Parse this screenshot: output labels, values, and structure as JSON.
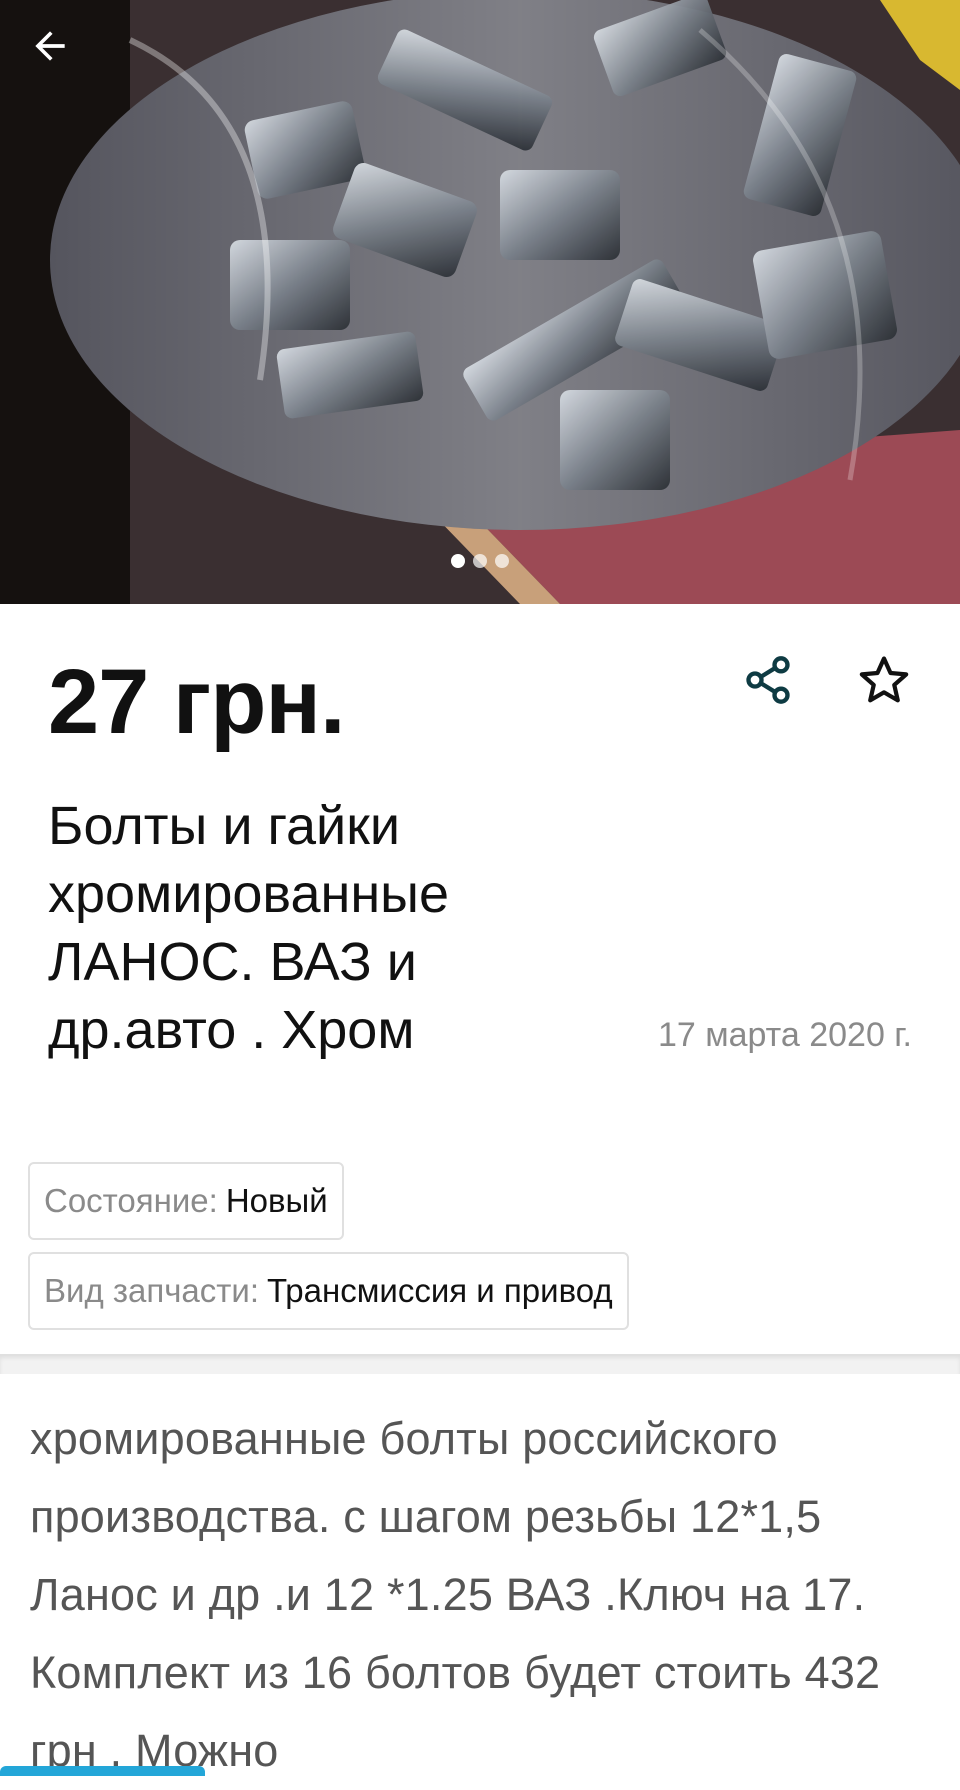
{
  "photo": {
    "alt": "bolts-photo",
    "slide_count": 3,
    "active_slide": 0
  },
  "listing": {
    "price": "27 грн.",
    "title": "Болты и гайки хромированные ЛАНОС. ВАЗ и др.авто . Хром",
    "date": "17 марта 2020 г.",
    "attributes": [
      {
        "key": "Состояние:",
        "value": "Новый"
      },
      {
        "key": "Вид запчасти:",
        "value": "Трансмиссия и привод"
      }
    ],
    "description": "хромированные болты российского производства. с шагом резьбы 12*1,5 Ланос и др .и 12 *1.25 ВАЗ .Ключ на 17. Комплект из 16 болтов будет стоить 432 грн . Можно"
  },
  "icons": {
    "back": "arrow-left-icon",
    "share": "share-icon",
    "favorite": "star-outline-icon"
  },
  "colors": {
    "accent": "#23a6d8",
    "icon_dark": "#0e3b43",
    "muted_text": "#8a8a8a"
  }
}
